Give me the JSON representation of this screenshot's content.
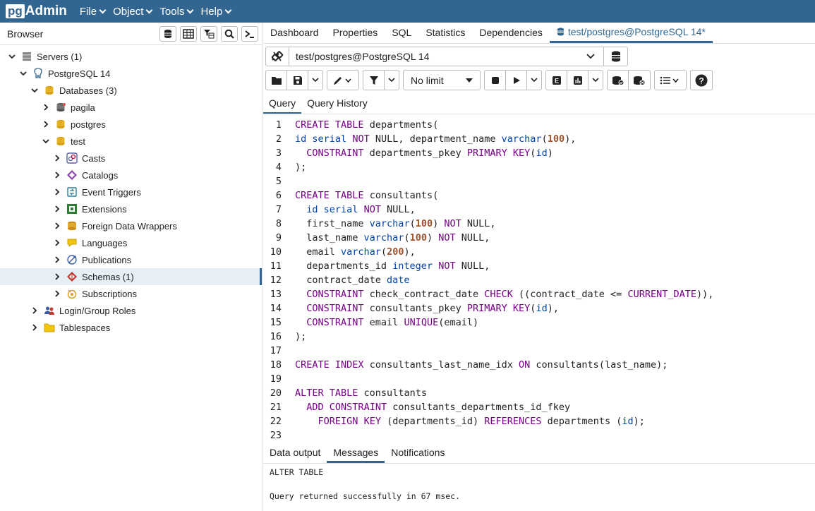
{
  "app": {
    "logo_pg": "pg",
    "logo_admin": "Admin"
  },
  "menu": [
    "File",
    "Object",
    "Tools",
    "Help"
  ],
  "browser": {
    "title": "Browser",
    "tree": [
      {
        "label": "Servers (1)",
        "level": 0,
        "expanded": true,
        "icon": "servers-icon"
      },
      {
        "label": "PostgreSQL 14",
        "level": 1,
        "expanded": true,
        "icon": "elephant-icon"
      },
      {
        "label": "Databases (3)",
        "level": 2,
        "expanded": true,
        "icon": "databases-icon"
      },
      {
        "label": "pagila",
        "level": 3,
        "expanded": false,
        "icon": "database-disconnected-icon"
      },
      {
        "label": "postgres",
        "level": 3,
        "expanded": false,
        "icon": "database-icon"
      },
      {
        "label": "test",
        "level": 3,
        "expanded": true,
        "icon": "database-icon"
      },
      {
        "label": "Casts",
        "level": 4,
        "expanded": false,
        "icon": "casts-icon"
      },
      {
        "label": "Catalogs",
        "level": 4,
        "expanded": false,
        "icon": "catalogs-icon"
      },
      {
        "label": "Event Triggers",
        "level": 4,
        "expanded": false,
        "icon": "event-triggers-icon"
      },
      {
        "label": "Extensions",
        "level": 4,
        "expanded": false,
        "icon": "extensions-icon"
      },
      {
        "label": "Foreign Data Wrappers",
        "level": 4,
        "expanded": false,
        "icon": "foreign-data-wrappers-icon"
      },
      {
        "label": "Languages",
        "level": 4,
        "expanded": false,
        "icon": "languages-icon"
      },
      {
        "label": "Publications",
        "level": 4,
        "expanded": false,
        "icon": "publications-icon"
      },
      {
        "label": "Schemas (1)",
        "level": 4,
        "expanded": false,
        "icon": "schemas-icon",
        "selected": true
      },
      {
        "label": "Subscriptions",
        "level": 4,
        "expanded": false,
        "icon": "subscriptions-icon"
      },
      {
        "label": "Login/Group Roles",
        "level": 2,
        "expanded": false,
        "icon": "roles-icon"
      },
      {
        "label": "Tablespaces",
        "level": 2,
        "expanded": false,
        "icon": "tablespaces-icon"
      }
    ]
  },
  "tabs": [
    "Dashboard",
    "Properties",
    "SQL",
    "Statistics",
    "Dependencies"
  ],
  "active_tab": "test/postgres@PostgreSQL 14*",
  "connection": "test/postgres@PostgreSQL 14",
  "limit": "No limit",
  "query_tabs": [
    "Query",
    "Query History"
  ],
  "code": [
    "CREATE TABLE departments(",
    "id serial NOT NULL, department_name varchar(100),",
    "  CONSTRAINT departments_pkey PRIMARY KEY(id)",
    ");",
    "",
    "CREATE TABLE consultants(",
    "  id serial NOT NULL,",
    "  first_name varchar(100) NOT NULL,",
    "  last_name varchar(100) NOT NULL,",
    "  email varchar(200),",
    "  departments_id integer NOT NULL,",
    "  contract_date date",
    "  CONSTRAINT check_contract_date CHECK ((contract_date <= CURRENT_DATE)),",
    "  CONSTRAINT consultants_pkey PRIMARY KEY(id),",
    "  CONSTRAINT email UNIQUE(email)",
    ");",
    "",
    "CREATE INDEX consultants_last_name_idx ON consultants(last_name);",
    "",
    "ALTER TABLE consultants",
    "  ADD CONSTRAINT consultants_departments_id_fkey",
    "    FOREIGN KEY (departments_id) REFERENCES departments (id);",
    ""
  ],
  "output_tabs": [
    "Data output",
    "Messages",
    "Notifications"
  ],
  "messages": [
    "ALTER TABLE",
    "Query returned successfully in 67 msec."
  ]
}
